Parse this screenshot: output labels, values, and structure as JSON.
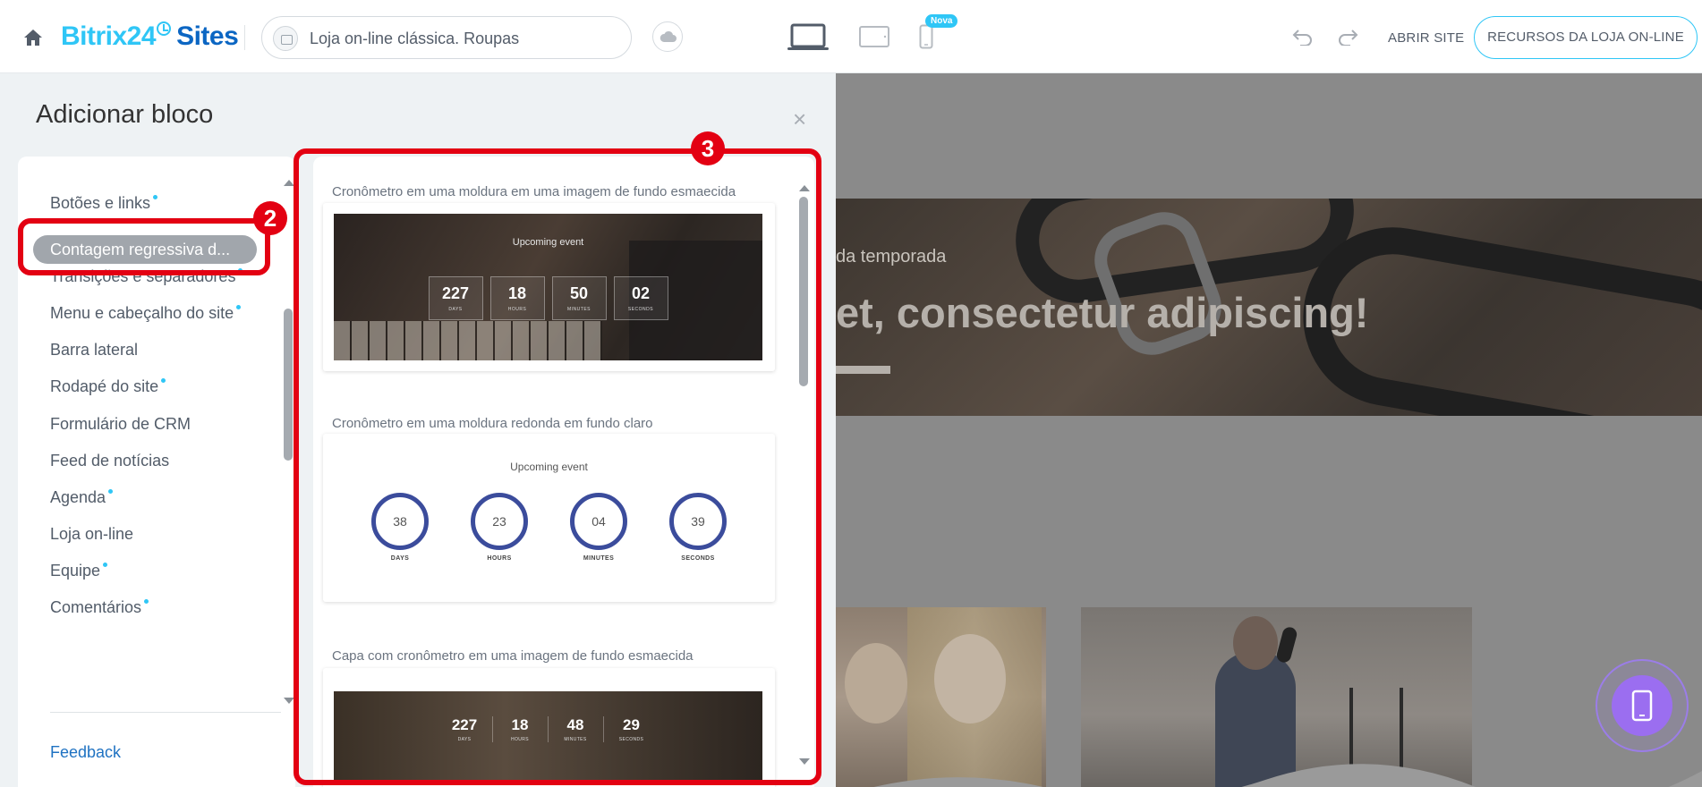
{
  "topbar": {
    "logo_brand": "Bitrix24",
    "logo_product": "Sites",
    "site_name": "Loja on-line clássica. Roupas",
    "new_badge": "Nova",
    "open_site": "ABRIR SITE",
    "resources": "RECURSOS DA LOJA ON-LINE"
  },
  "panel": {
    "title": "Adicionar bloco",
    "close_icon": "×",
    "categories": [
      {
        "label": "Botões e links",
        "new": true
      },
      {
        "label": "Contagem regressiva d...",
        "new": false,
        "active": true
      },
      {
        "label": "Transições e separadores",
        "new": true
      },
      {
        "label": "Menu e cabeçalho do site",
        "new": true
      },
      {
        "label": "Barra lateral",
        "new": false
      },
      {
        "label": "Rodapé do site",
        "new": true
      },
      {
        "label": "Formulário de CRM",
        "new": false
      },
      {
        "label": "Feed de notícias",
        "new": false
      },
      {
        "label": "Agenda",
        "new": true
      },
      {
        "label": "Loja on-line",
        "new": false
      },
      {
        "label": "Equipe",
        "new": true
      },
      {
        "label": "Comentários",
        "new": true
      }
    ],
    "feedback": "Feedback",
    "blocks": [
      {
        "label": "Cronômetro em uma moldura em uma imagem de fundo esmaecida",
        "event": "Upcoming event",
        "units": [
          {
            "value": "227",
            "unit": "DAYS"
          },
          {
            "value": "18",
            "unit": "HOURS"
          },
          {
            "value": "50",
            "unit": "MINUTES"
          },
          {
            "value": "02",
            "unit": "SECONDS"
          }
        ]
      },
      {
        "label": "Cronômetro em uma moldura redonda em fundo claro",
        "event": "Upcoming event",
        "units": [
          {
            "value": "38",
            "unit": "DAYS"
          },
          {
            "value": "23",
            "unit": "HOURS"
          },
          {
            "value": "04",
            "unit": "MINUTES"
          },
          {
            "value": "39",
            "unit": "SECONDS"
          }
        ]
      },
      {
        "label": "Capa com cronômetro em uma imagem de fundo esmaecida",
        "units": [
          {
            "value": "227",
            "unit": "DAYS"
          },
          {
            "value": "18",
            "unit": "HOURS"
          },
          {
            "value": "48",
            "unit": "MINUTES"
          },
          {
            "value": "29",
            "unit": "SECONDS"
          }
        ]
      }
    ]
  },
  "annotations": {
    "badge_2": "2",
    "badge_3": "3",
    "color": "#e30012"
  },
  "background_page": {
    "hero_subtitle": "da temporada",
    "hero_title": "et, consectetur adipiscing!"
  },
  "colors": {
    "accent": "#2fc6f6",
    "brand_dark": "#0b66c3",
    "circle_ring": "#3b4c9c",
    "fab": "#9b6ef0"
  }
}
